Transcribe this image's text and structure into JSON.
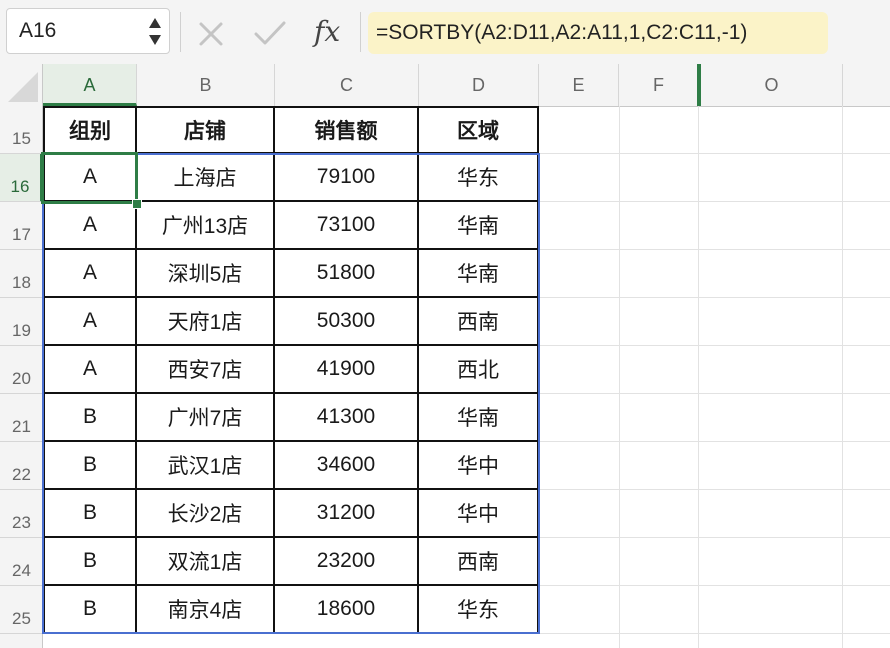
{
  "name_box": {
    "value": "A16"
  },
  "formula_bar": {
    "fx_label": "fx",
    "formula": "=SORTBY(A2:D11,A2:A11,1,C2:C11,-1)"
  },
  "columns": [
    "A",
    "B",
    "C",
    "D",
    "E",
    "F",
    "O"
  ],
  "active_column": "A",
  "rows": [
    "15",
    "16",
    "17",
    "18",
    "19",
    "20",
    "21",
    "22",
    "23",
    "24",
    "25"
  ],
  "active_row": "16",
  "table": {
    "headers": [
      "组别",
      "店铺",
      "销售额",
      "区域"
    ],
    "rows": [
      [
        "A",
        "上海店",
        "79100",
        "华东"
      ],
      [
        "A",
        "广州13店",
        "73100",
        "华南"
      ],
      [
        "A",
        "深圳5店",
        "51800",
        "华南"
      ],
      [
        "A",
        "天府1店",
        "50300",
        "西南"
      ],
      [
        "A",
        "西安7店",
        "41900",
        "西北"
      ],
      [
        "B",
        "广州7店",
        "41300",
        "华南"
      ],
      [
        "B",
        "武汉1店",
        "34600",
        "华中"
      ],
      [
        "B",
        "长沙2店",
        "31200",
        "华中"
      ],
      [
        "B",
        "双流1店",
        "23200",
        "西南"
      ],
      [
        "B",
        "南京4店",
        "18600",
        "华东"
      ]
    ]
  },
  "colors": {
    "accent_green": "#2e7d46",
    "formula_highlight": "#fbf3c8",
    "selection_blue": "#4a6fd0"
  },
  "icons": [
    "cancel-icon",
    "enter-icon",
    "fx-icon",
    "stepper-icon"
  ]
}
